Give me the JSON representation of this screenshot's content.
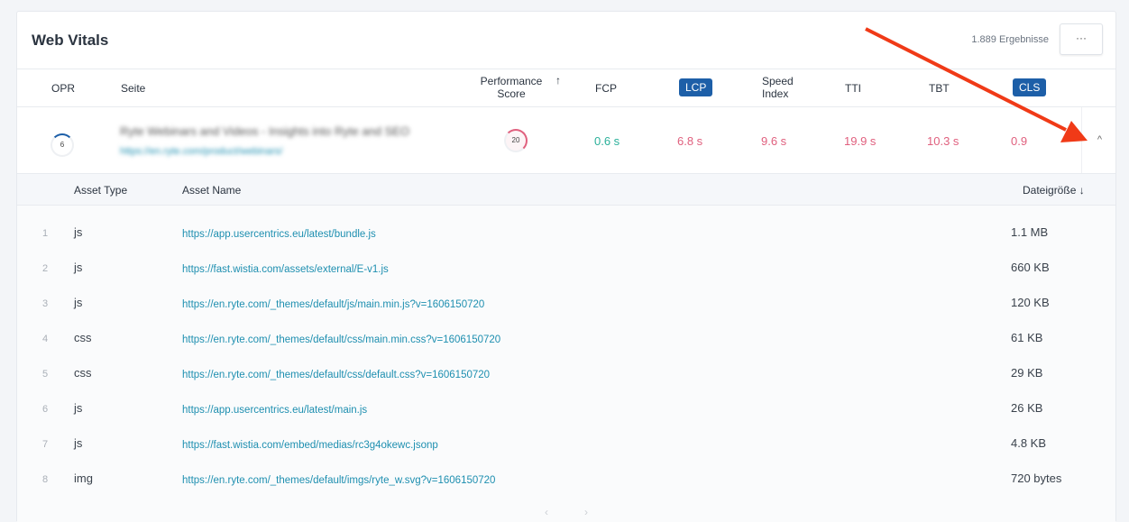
{
  "header": {
    "title": "Web Vitals",
    "results": "1.889 Ergebnisse",
    "more_label": "···"
  },
  "columns": {
    "opr": "OPR",
    "page": "Seite",
    "perf": "Performance Score",
    "sort_icon": "↑",
    "fcp": "FCP",
    "lcp": "LCP",
    "si": "Speed Index",
    "tti": "TTI",
    "tbt": "TBT",
    "cls": "CLS"
  },
  "row": {
    "opr": "6",
    "title": "Ryte Webinars and Videos - Insights into Ryte and SEO",
    "url": "https://en.ryte.com/product/webinars/",
    "score": "20",
    "fcp": "0.6 s",
    "lcp": "6.8 s",
    "si": "9.6 s",
    "tti": "19.9 s",
    "tbt": "10.3 s",
    "cls": "0.9",
    "collapse_icon": "^"
  },
  "assets_header": {
    "type": "Asset Type",
    "name": "Asset Name",
    "size": "Dateigröße ↓"
  },
  "assets": [
    {
      "n": "1",
      "type": "js",
      "url": "https://app.usercentrics.eu/latest/bundle.js",
      "size": "1.1 MB"
    },
    {
      "n": "2",
      "type": "js",
      "url": "https://fast.wistia.com/assets/external/E-v1.js",
      "size": "660 KB"
    },
    {
      "n": "3",
      "type": "js",
      "url": "https://en.ryte.com/_themes/default/js/main.min.js?v=1606150720",
      "size": "120 KB"
    },
    {
      "n": "4",
      "type": "css",
      "url": "https://en.ryte.com/_themes/default/css/main.min.css?v=1606150720",
      "size": "61 KB"
    },
    {
      "n": "5",
      "type": "css",
      "url": "https://en.ryte.com/_themes/default/css/default.css?v=1606150720",
      "size": "29 KB"
    },
    {
      "n": "6",
      "type": "js",
      "url": "https://app.usercentrics.eu/latest/main.js",
      "size": "26 KB"
    },
    {
      "n": "7",
      "type": "js",
      "url": "https://fast.wistia.com/embed/medias/rc3g4okewc.jsonp",
      "size": "4.8 KB"
    },
    {
      "n": "8",
      "type": "img",
      "url": "https://en.ryte.com/_themes/default/imgs/ryte_w.svg?v=1606150720",
      "size": "720 bytes"
    }
  ],
  "pagination": {
    "prev": "‹",
    "next": "›"
  },
  "colors": {
    "accent": "#1d5fa8",
    "good": "#2bb09a",
    "bad": "#e0607e",
    "arrow": "#f03a17"
  }
}
